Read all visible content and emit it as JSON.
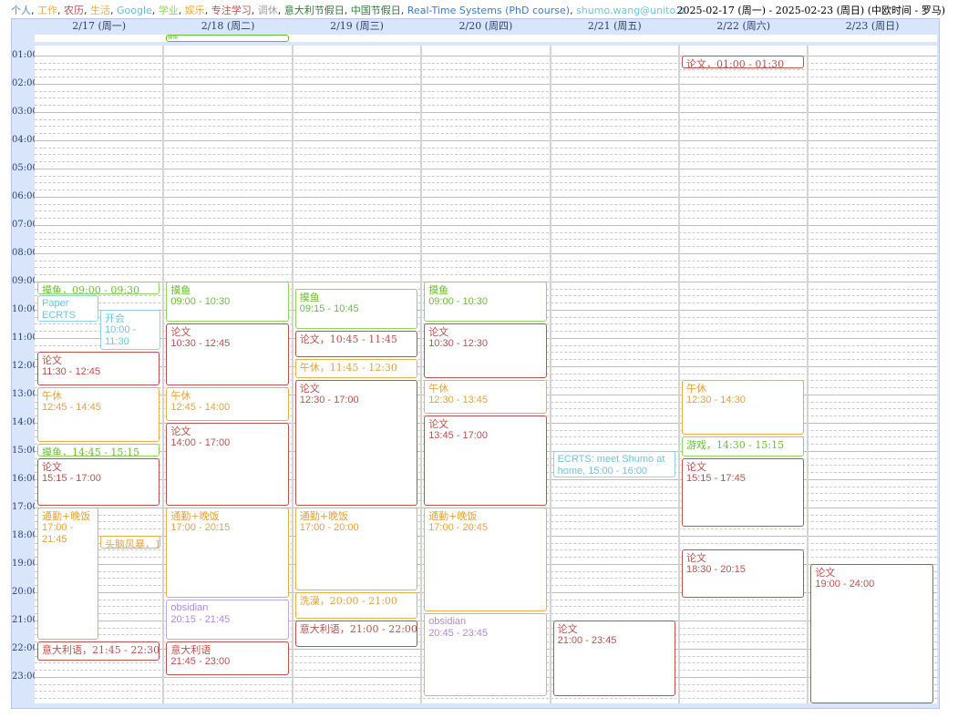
{
  "calendars": [
    {
      "name": "个人",
      "color": "#4a90d9"
    },
    {
      "name": "工作",
      "color": "#f0ad4e"
    },
    {
      "name": "农历",
      "color": "#c0504d"
    },
    {
      "name": "生活",
      "color": "#f0ad4e"
    },
    {
      "name": "Google",
      "color": "#5bc0de"
    },
    {
      "name": "学业",
      "color": "#8fd65a"
    },
    {
      "name": "娱乐",
      "color": "#f0ad4e"
    },
    {
      "name": "专注学习",
      "color": "#c0504d"
    },
    {
      "name": "调休",
      "color": "#a0a0a0"
    },
    {
      "name": "意大利节假日",
      "color": "#2e7d32"
    },
    {
      "name": "中国节假日",
      "color": "#2e7d32"
    },
    {
      "name": "Real-Time Systems (PhD course)",
      "color": "#3a7bd5"
    },
    {
      "name": "shumo.wang@unito.it",
      "color": "#6cc6df"
    }
  ],
  "date_range": "2025-02-17 (周一) - 2025-02-23 (周日) (中欧时间 - 罗马)",
  "days": [
    "2/17 (周一)",
    "2/18 (周二)",
    "2/19 (周三)",
    "2/20 (周四)",
    "2/21 (周五)",
    "2/22 (周六)",
    "2/23 (周日)"
  ],
  "hours": [
    "01:00",
    "02:00",
    "03:00",
    "04:00",
    "05:00",
    "06:00",
    "07:00",
    "08:00",
    "09:00",
    "10:00",
    "11:00",
    "12:00",
    "13:00",
    "14:00",
    "15:00",
    "16:00",
    "17:00",
    "18:00",
    "19:00",
    "20:00",
    "21:00",
    "22:00",
    "23:00"
  ],
  "all_day_event": {
    "title": "摸鱼",
    "day": 1
  },
  "events": [
    {
      "day": 0,
      "title": "摸鱼，09:00 - 09:30",
      "time": "",
      "color": "green",
      "start": 9.0,
      "end": 9.5,
      "inline": true
    },
    {
      "day": 0,
      "title": "Paper ECRTS",
      "time": "",
      "color": "cyan",
      "start": 9.5,
      "end": 10.5,
      "sub": "left",
      "sans": true
    },
    {
      "day": 0,
      "title": "开会",
      "time": "10:00 - 11:30",
      "color": "cyan",
      "start": 10.0,
      "end": 11.5,
      "sub": "right",
      "sans_time": true
    },
    {
      "day": 0,
      "title": "论文",
      "time": "11:30 - 12:45",
      "color": "red",
      "start": 11.5,
      "end": 12.75
    },
    {
      "day": 0,
      "title": "午休",
      "time": "12:45 - 14:45",
      "color": "orange",
      "start": 12.75,
      "end": 14.75
    },
    {
      "day": 0,
      "title": "摸鱼，14:45 - 15:15",
      "time": "",
      "color": "green",
      "start": 14.75,
      "end": 15.25,
      "inline": true
    },
    {
      "day": 0,
      "title": "论文",
      "time": "15:15 - 17:00",
      "color": "red",
      "start": 15.25,
      "end": 17.0
    },
    {
      "day": 0,
      "title": "通勤+晚饭",
      "time": "17:00 - 21:45",
      "color": "orange",
      "start": 17.0,
      "end": 21.75,
      "sub": "left"
    },
    {
      "day": 0,
      "title": "头脑风暴，18:",
      "time": "",
      "color": "orange",
      "start": 18.0,
      "end": 18.5,
      "sub": "right",
      "inline": true
    },
    {
      "day": 0,
      "title": "意大利语，21:45 - 22:30",
      "time": "",
      "color": "red",
      "start": 21.75,
      "end": 22.5,
      "inline": true
    },
    {
      "day": 1,
      "title": "摸鱼",
      "time": "09:00 - 10:30",
      "color": "green",
      "start": 9.0,
      "end": 10.5
    },
    {
      "day": 1,
      "title": "论文",
      "time": "10:30 - 12:45",
      "color": "red",
      "start": 10.5,
      "end": 12.75
    },
    {
      "day": 1,
      "title": "午休",
      "time": "12:45 - 14:00",
      "color": "orange",
      "start": 12.75,
      "end": 14.0
    },
    {
      "day": 1,
      "title": "论文",
      "time": "14:00 - 17:00",
      "color": "red",
      "start": 14.0,
      "end": 17.0
    },
    {
      "day": 1,
      "title": "通勤+晚饭",
      "time": "17:00 - 20:15",
      "color": "orange",
      "start": 17.0,
      "end": 20.25
    },
    {
      "day": 1,
      "title": "obsidian",
      "time": "20:15 - 21:45",
      "color": "purple",
      "start": 20.25,
      "end": 21.75,
      "sans": true
    },
    {
      "day": 1,
      "title": "意大利语",
      "time": "21:45 - 23:00",
      "color": "red",
      "start": 21.75,
      "end": 23.0
    },
    {
      "day": 2,
      "title": "摸鱼",
      "time": "09:15 - 10:45",
      "color": "green",
      "start": 9.25,
      "end": 10.75
    },
    {
      "day": 2,
      "title": "论文，10:45 - 11:45",
      "time": "",
      "color": "red",
      "start": 10.75,
      "end": 11.75,
      "inline": true
    },
    {
      "day": 2,
      "title": "午休，11:45 - 12:30",
      "time": "",
      "color": "orange",
      "start": 11.75,
      "end": 12.5,
      "inline": true
    },
    {
      "day": 2,
      "title": "论文",
      "time": "12:30 - 17:00",
      "color": "red",
      "start": 12.5,
      "end": 17.0
    },
    {
      "day": 2,
      "title": "通勤+晚饭",
      "time": "17:00 - 20:00",
      "color": "orange",
      "start": 17.0,
      "end": 20.0
    },
    {
      "day": 2,
      "title": "洗澡，20:00 - 21:00",
      "time": "",
      "color": "orange",
      "start": 20.0,
      "end": 21.0,
      "inline": true
    },
    {
      "day": 2,
      "title": "意大利语，21:00 - 22:00",
      "time": "",
      "color": "red",
      "start": 21.0,
      "end": 22.0,
      "inline": true
    },
    {
      "day": 3,
      "title": "摸鱼",
      "time": "09:00 - 10:30",
      "color": "green",
      "start": 9.0,
      "end": 10.5
    },
    {
      "day": 3,
      "title": "论文",
      "time": "10:30 - 12:30",
      "color": "red",
      "start": 10.5,
      "end": 12.5
    },
    {
      "day": 3,
      "title": "午休",
      "time": "12:30 - 13:45",
      "color": "orange",
      "start": 12.5,
      "end": 13.75
    },
    {
      "day": 3,
      "title": "论文",
      "time": "13:45 - 17:00",
      "color": "red",
      "start": 13.75,
      "end": 17.0
    },
    {
      "day": 3,
      "title": "通勤+晚饭",
      "time": "17:00 - 20:45",
      "color": "orange",
      "start": 17.0,
      "end": 20.75
    },
    {
      "day": 3,
      "title": "obsidian",
      "time": "20:45 - 23:45",
      "color": "purple",
      "start": 20.75,
      "end": 23.75,
      "sans": true
    },
    {
      "day": 4,
      "title": "ECRTS: meet Shumo at home, 15:00 - 16:00",
      "time": "",
      "color": "cyan",
      "start": 15.0,
      "end": 16.0,
      "inline": true,
      "sans": true
    },
    {
      "day": 4,
      "title": "论文",
      "time": "21:00 - 23:45",
      "color": "red",
      "start": 21.0,
      "end": 23.75
    },
    {
      "day": 5,
      "title": "论文，01:00 - 01:30",
      "time": "",
      "color": "red",
      "start": 1.0,
      "end": 1.5,
      "inline": true
    },
    {
      "day": 5,
      "title": "午休",
      "time": "12:30 - 14:30",
      "color": "orange",
      "start": 12.5,
      "end": 14.5
    },
    {
      "day": 5,
      "title": "游戏，14:30 - 15:15",
      "time": "",
      "color": "green",
      "start": 14.5,
      "end": 15.25,
      "inline": true
    },
    {
      "day": 5,
      "title": "论文",
      "time": "15:15 - 17:45",
      "color": "red",
      "start": 15.25,
      "end": 17.75
    },
    {
      "day": 5,
      "title": "论文",
      "time": "18:30 - 20:15",
      "color": "red",
      "start": 18.5,
      "end": 20.25
    },
    {
      "day": 6,
      "title": "论文",
      "time": "19:00 - 24:00",
      "color": "red",
      "start": 19.0,
      "end": 24.0
    }
  ]
}
